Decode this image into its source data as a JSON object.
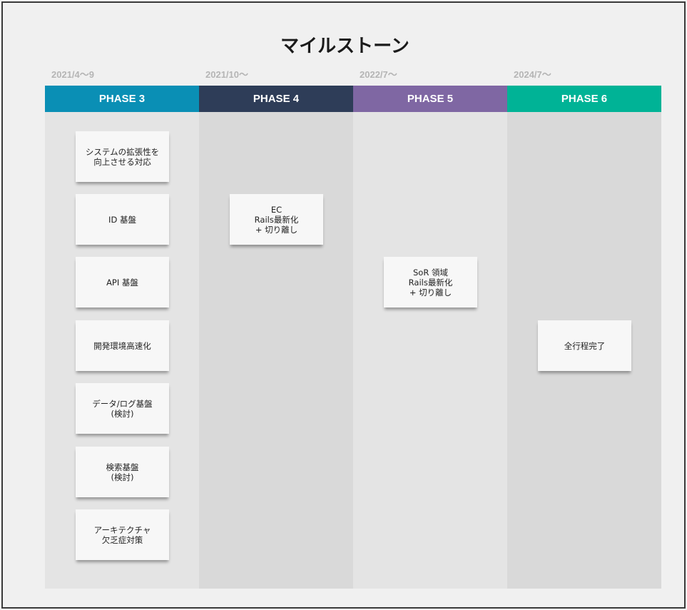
{
  "title": "マイルストーン",
  "columns": [
    {
      "date": "2021/4〜9",
      "phase": "PHASE 3",
      "color": "#0a8fb5",
      "notes": [
        "システムの拡張性を\n向上させる対応",
        "ID 基盤",
        "API 基盤",
        "開発環境高速化",
        "データ/ログ基盤\n(検討)",
        "検索基盤\n(検討)",
        "アーキテクチャ\n欠乏症対策"
      ]
    },
    {
      "date": "2021/10〜",
      "phase": "PHASE 4",
      "color": "#2e3d58",
      "notes": [
        "EC\nRails最新化\n+ 切り離し"
      ]
    },
    {
      "date": "2022/7〜",
      "phase": "PHASE 5",
      "color": "#7f67a3",
      "notes": [
        "SoR 領域\nRails最新化\n+ 切り離し"
      ]
    },
    {
      "date": "2024/7〜",
      "phase": "PHASE 6",
      "color": "#00b396",
      "notes": [
        "全行程完了"
      ]
    }
  ]
}
